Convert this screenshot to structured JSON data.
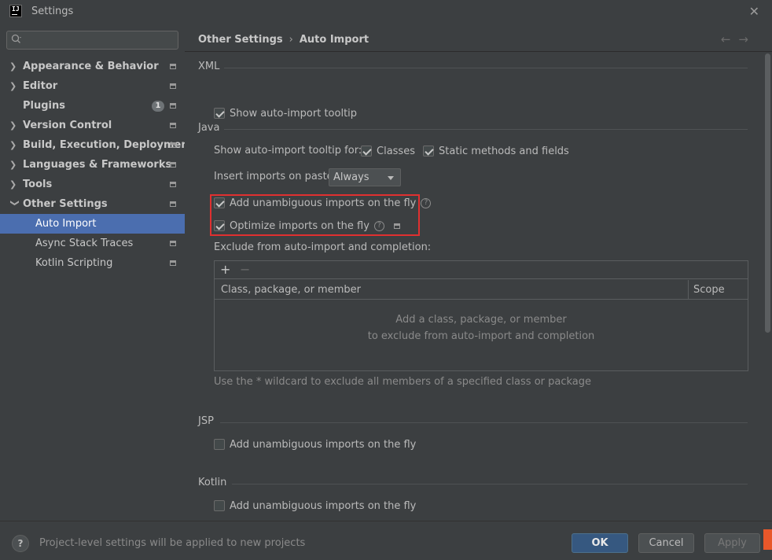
{
  "window": {
    "title": "Settings",
    "logo_text": "IJ"
  },
  "sidebar": {
    "search_placeholder": "",
    "items": [
      {
        "label": "Appearance & Behavior",
        "expandable": true,
        "expanded": false
      },
      {
        "label": "Editor",
        "expandable": true,
        "expanded": false
      },
      {
        "label": "Plugins",
        "expandable": false,
        "badge": "1"
      },
      {
        "label": "Version Control",
        "expandable": true,
        "expanded": false
      },
      {
        "label": "Build, Execution, Deployment",
        "expandable": true,
        "expanded": false
      },
      {
        "label": "Languages & Frameworks",
        "expandable": true,
        "expanded": false
      },
      {
        "label": "Tools",
        "expandable": true,
        "expanded": false
      },
      {
        "label": "Other Settings",
        "expandable": true,
        "expanded": true
      },
      {
        "label": "Auto Import",
        "child": true,
        "selected": true
      },
      {
        "label": "Async Stack Traces",
        "child": true
      },
      {
        "label": "Kotlin Scripting",
        "child": true
      }
    ]
  },
  "breadcrumb": {
    "parent": "Other Settings",
    "separator": "›",
    "current": "Auto Import"
  },
  "sections": {
    "xml": {
      "title": "XML",
      "show_tooltip": {
        "label": "Show auto-import tooltip",
        "checked": true
      }
    },
    "java": {
      "title": "Java",
      "tooltip_for_label": "Show auto-import tooltip for:",
      "classes": {
        "label": "Classes",
        "checked": true
      },
      "static_methods": {
        "label": "Static methods and fields",
        "checked": true
      },
      "insert_on_paste_label": "Insert imports on paste:",
      "insert_on_paste_value": "Always",
      "add_unambiguous": {
        "label": "Add unambiguous imports on the fly",
        "checked": true
      },
      "optimize_imports": {
        "label": "Optimize imports on the fly",
        "checked": true
      },
      "exclude_label": "Exclude from auto-import and completion:",
      "table": {
        "add": "+",
        "remove": "−",
        "col_member": "Class, package, or member",
        "col_scope": "Scope",
        "empty_line1": "Add a class, package, or member",
        "empty_line2": "to exclude from auto-import and completion"
      },
      "wildcard_hint": "Use the * wildcard to exclude all members of a specified class or package"
    },
    "jsp": {
      "title": "JSP",
      "add_unambiguous": {
        "label": "Add unambiguous imports on the fly",
        "checked": false
      }
    },
    "kotlin": {
      "title": "Kotlin",
      "add_unambiguous": {
        "label": "Add unambiguous imports on the fly",
        "checked": false
      }
    }
  },
  "footer": {
    "help": "?",
    "note": "Project-level settings will be applied to new projects",
    "ok": "OK",
    "cancel": "Cancel",
    "apply": "Apply"
  },
  "colors": {
    "background": "#3c3f41",
    "selection": "#4b6eaf",
    "ok_button": "#365880",
    "highlight_box": "#e03030"
  }
}
